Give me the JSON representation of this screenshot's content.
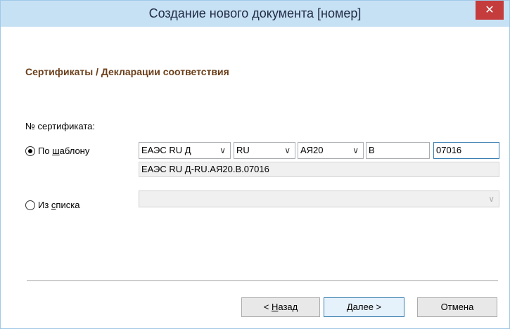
{
  "window": {
    "title": "Создание нового документа [номер]",
    "close_glyph": "✕"
  },
  "section": {
    "title": "Сертификаты / Декларации соответствия"
  },
  "form": {
    "cert_label": "№ сертификата:",
    "option_template": {
      "pre": "По ",
      "accel": "ш",
      "post": "аблону",
      "checked": true
    },
    "option_list": {
      "pre": "Из ",
      "accel": "с",
      "post": "писка",
      "checked": false
    },
    "template_parts": {
      "part1": "ЕАЭС RU Д",
      "part2": "RU",
      "part3": "АЯ20",
      "part4": "В",
      "part5": "07016"
    },
    "preview": "ЕАЭС RU Д-RU.АЯ20.В.07016",
    "list_value": ""
  },
  "buttons": {
    "back": {
      "pre": "< ",
      "accel": "Н",
      "post": "азад"
    },
    "next": {
      "pre": "",
      "accel": "Д",
      "post": "алее >"
    },
    "cancel": "Отмена"
  },
  "icons": {
    "chevron": "chevron-down-icon",
    "close": "close-icon"
  }
}
